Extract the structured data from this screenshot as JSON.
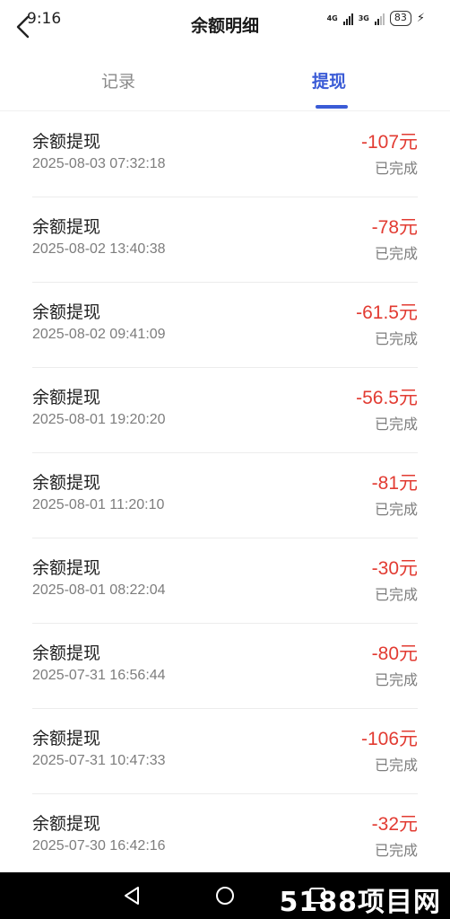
{
  "status_bar": {
    "time": "9:16",
    "network_1": "4G",
    "network_2": "3G",
    "battery": "83"
  },
  "header": {
    "title": "余额明细"
  },
  "tabs": [
    {
      "label": "记录",
      "active": false
    },
    {
      "label": "提现",
      "active": true
    }
  ],
  "list": [
    {
      "title": "余额提现",
      "date": "2025-08-03 07:32:18",
      "amount": "-107元",
      "status": "已完成"
    },
    {
      "title": "余额提现",
      "date": "2025-08-02 13:40:38",
      "amount": "-78元",
      "status": "已完成"
    },
    {
      "title": "余额提现",
      "date": "2025-08-02 09:41:09",
      "amount": "-61.5元",
      "status": "已完成"
    },
    {
      "title": "余额提现",
      "date": "2025-08-01 19:20:20",
      "amount": "-56.5元",
      "status": "已完成"
    },
    {
      "title": "余额提现",
      "date": "2025-08-01 11:20:10",
      "amount": "-81元",
      "status": "已完成"
    },
    {
      "title": "余额提现",
      "date": "2025-08-01 08:22:04",
      "amount": "-30元",
      "status": "已完成"
    },
    {
      "title": "余额提现",
      "date": "2025-07-31 16:56:44",
      "amount": "-80元",
      "status": "已完成"
    },
    {
      "title": "余额提现",
      "date": "2025-07-31 10:47:33",
      "amount": "-106元",
      "status": "已完成"
    },
    {
      "title": "余额提现",
      "date": "2025-07-30 16:42:16",
      "amount": "-32元",
      "status": "已完成"
    }
  ],
  "watermark": "5188项目网",
  "colors": {
    "accent": "#3a5bd6",
    "amount": "#e23b32",
    "muted": "#7d7d7d"
  }
}
